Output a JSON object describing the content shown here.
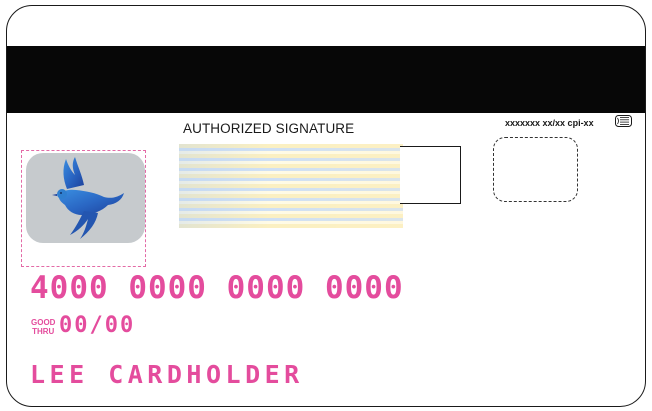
{
  "card": {
    "signature_label": "AUTHORIZED SIGNATURE",
    "code_text": "xxxxxxx xx/xx cpi-xx",
    "card_number": "4000 0000 0000 0000",
    "good_thru_line1": "GOOD",
    "good_thru_line2": "THRU",
    "expiry": "00/00",
    "cardholder_name": "LEE CARDHOLDER",
    "hologram_icon": "dove-hologram-icon",
    "chip_icon": "contactless-chip-icon"
  },
  "colors": {
    "accent": "#e44c9d",
    "stripe": "#070707",
    "hologram_bg": "#c6cacd",
    "dove": "#2f7fd0"
  }
}
